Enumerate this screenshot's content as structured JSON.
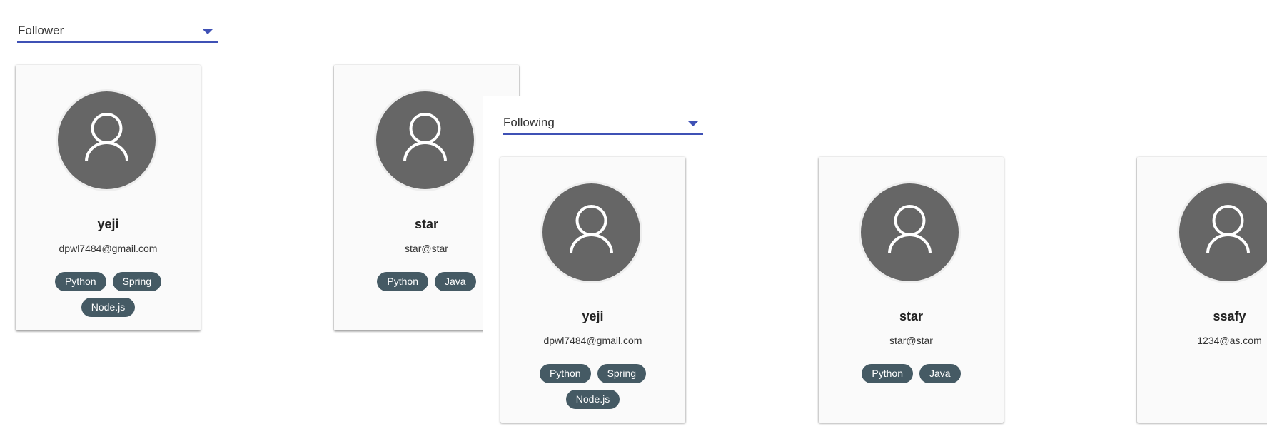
{
  "follower_panel": {
    "select_value": "Follower",
    "cards": [
      {
        "name": "yeji",
        "email": "dpwl7484@gmail.com",
        "tags": [
          "Python",
          "Spring",
          "Node.js"
        ]
      },
      {
        "name": "star",
        "email": "star@star",
        "tags": [
          "Python",
          "Java"
        ]
      }
    ]
  },
  "following_panel": {
    "select_value": "Following",
    "cards": [
      {
        "name": "yeji",
        "email": "dpwl7484@gmail.com",
        "tags": [
          "Python",
          "Spring",
          "Node.js"
        ]
      },
      {
        "name": "star",
        "email": "star@star",
        "tags": [
          "Python",
          "Java"
        ]
      },
      {
        "name": "ssafy",
        "email": "1234@as.com",
        "tags": []
      }
    ]
  },
  "colors": {
    "select_underline": "#3f51b5",
    "avatar_bg": "#666666",
    "chip_bg": "#455a64",
    "card_bg": "#fafafa"
  },
  "icons": {
    "avatar": "person-icon",
    "dropdown": "caret-down-icon"
  }
}
